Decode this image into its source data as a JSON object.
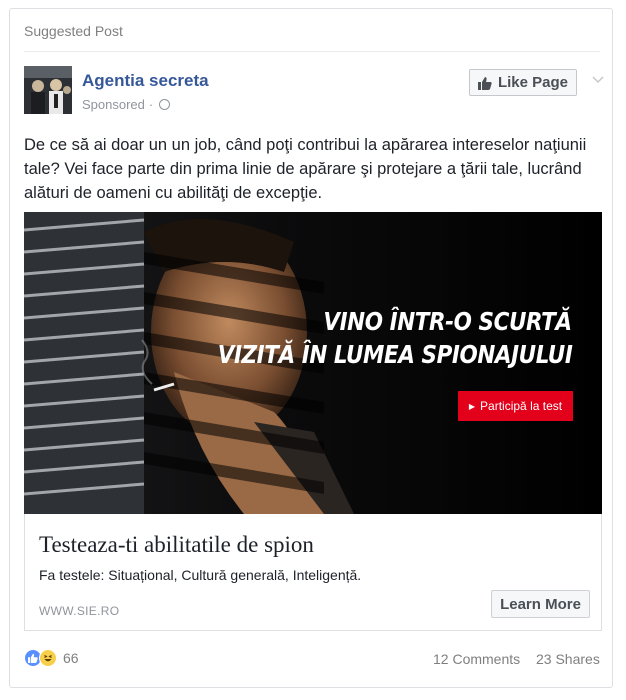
{
  "feed": {
    "suggested_label": "Suggested Post"
  },
  "post": {
    "page_name": "Agentia secreta",
    "sponsored_label": "Sponsored",
    "separator": "·",
    "like_page_label": "Like Page",
    "text": "De ce să ai doar un un job, când poţi contribui la apărarea intereselor naţiunii tale? Vei face parte din prima linie de apărare şi protejare a ţării tale, lucrând alături de oameni cu abilităţi de excepţie."
  },
  "ad_image": {
    "headline_line1": "VINO ÎNTR-O SCURTĂ",
    "headline_line2": "VIZITĂ ÎN LUMEA SPIONAJULUI",
    "cta_label": "Participă la test",
    "cta_color": "#e2001a"
  },
  "link": {
    "title": "Testeaza-ti abilitatile de spion",
    "description": "Fa testele: Situațional, Cultură generală, Inteligență.",
    "domain": "WWW.SIE.RO",
    "cta_label": "Learn More"
  },
  "footer": {
    "reaction_icons": [
      "like-icon",
      "haha-icon"
    ],
    "reaction_count": "66",
    "comments": "12 Comments",
    "shares": "23 Shares"
  },
  "colors": {
    "brand_blue": "#365899",
    "meta_gray": "#90949c",
    "border": "#dddfe2"
  }
}
